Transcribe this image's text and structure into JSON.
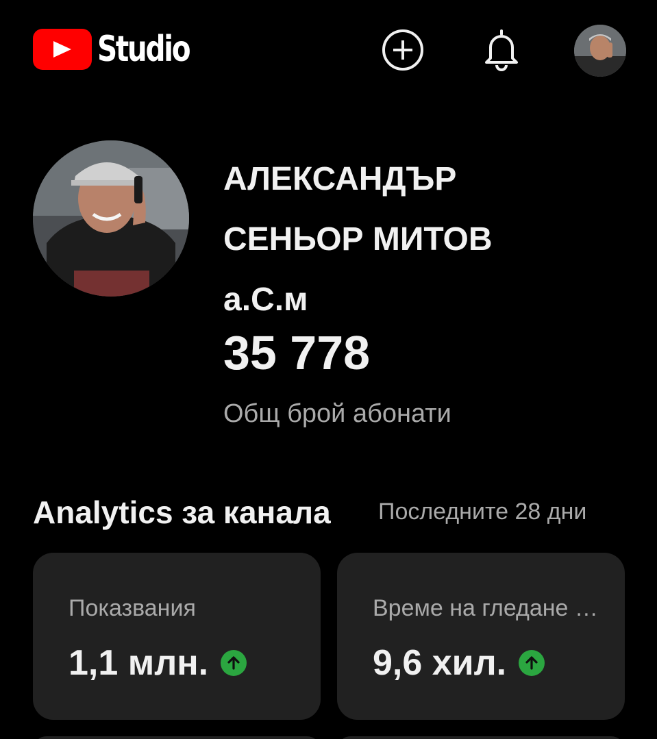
{
  "app": {
    "name": "Studio"
  },
  "header": {
    "create_icon": "add-circle-icon",
    "notifications_icon": "bell-icon",
    "account_icon": "account-avatar"
  },
  "channel": {
    "name_line1": "АЛЕКСАНДЪР",
    "name_line2": "СЕНЬОР МИТОВ",
    "name_line3": "а.С.м",
    "subscriber_count": "35 778",
    "subscriber_label": "Общ брой абонати"
  },
  "analytics": {
    "title": "Analytics за канала",
    "period": "Последните 28 дни",
    "cards": [
      {
        "label": "Показвания",
        "value": "1,1 млн.",
        "trend": "up"
      },
      {
        "label": "Време на гледане (часове)",
        "value": "9,6 хил.",
        "trend": "up"
      }
    ]
  },
  "colors": {
    "background": "#000000",
    "card": "#212121",
    "brand_red": "#ff0000",
    "trend_green": "#2ba640",
    "secondary_text": "#aaaaaa"
  }
}
